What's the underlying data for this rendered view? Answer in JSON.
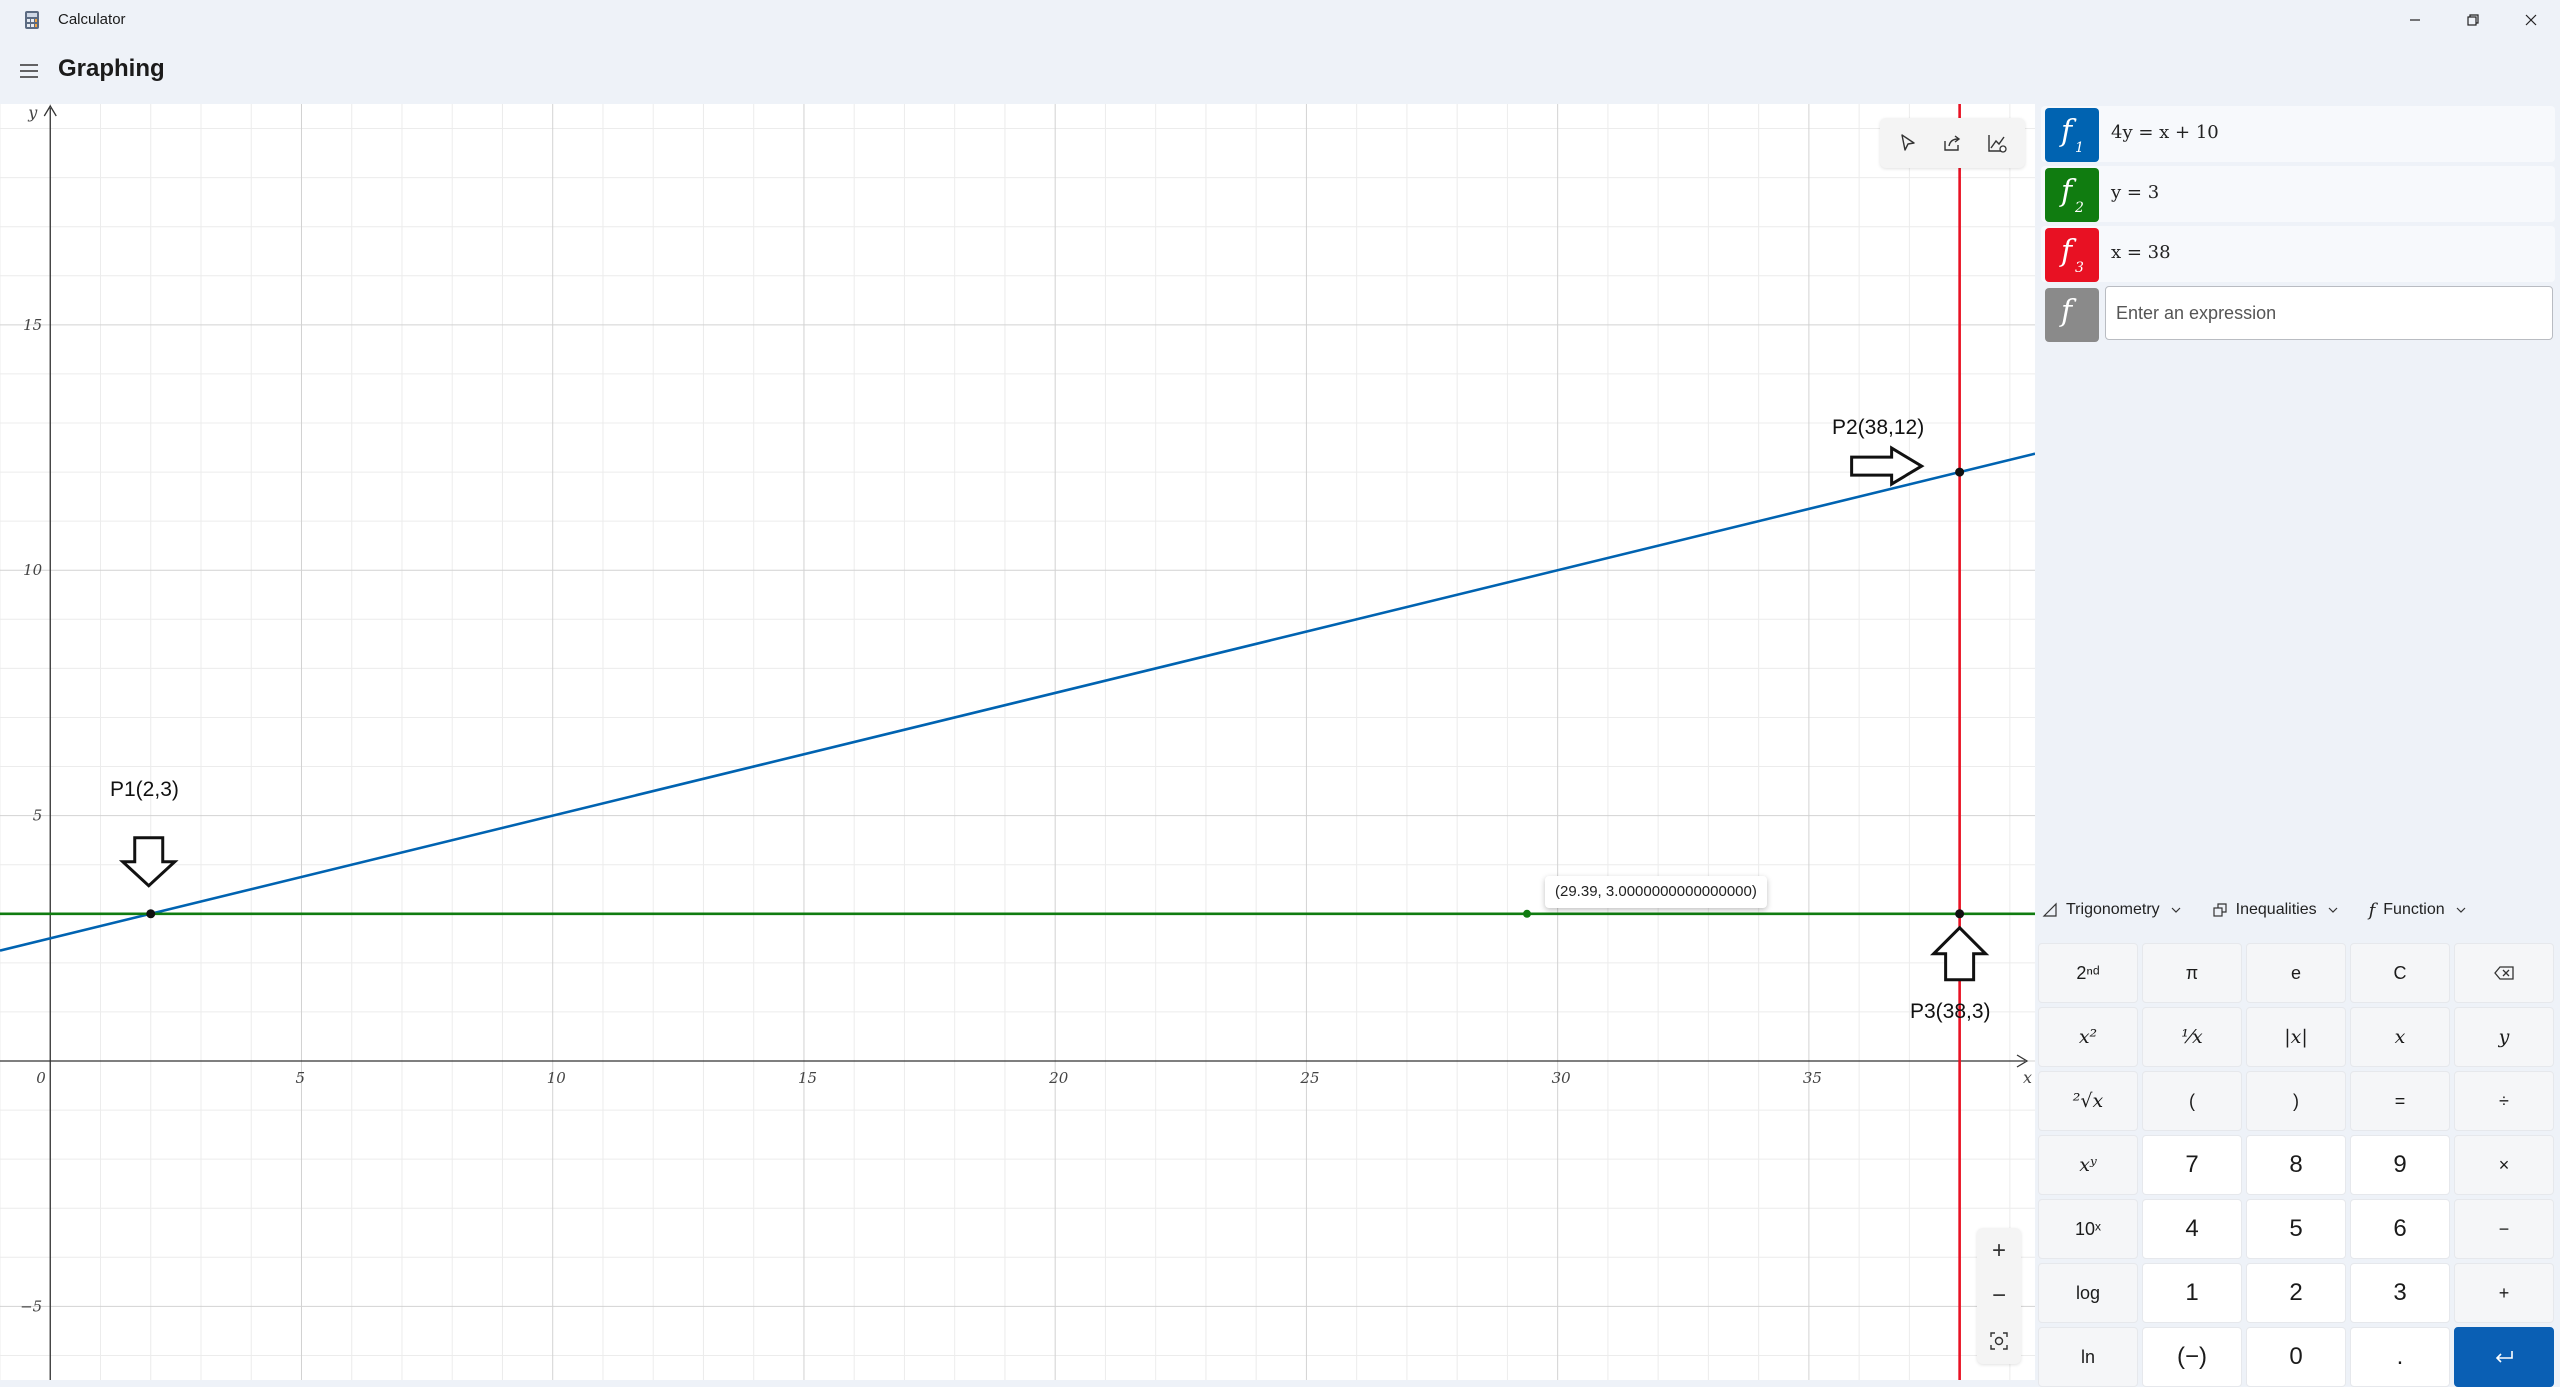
{
  "window": {
    "title": "Calculator",
    "controls": [
      "minimize",
      "maximize",
      "close"
    ]
  },
  "header": {
    "menu_icon": "hamburger-menu-icon",
    "page_title": "Graphing"
  },
  "graph": {
    "axes": {
      "x_label": "x",
      "y_label": "y",
      "x_ticks": [
        "0",
        "5",
        "10",
        "15",
        "20",
        "25",
        "30",
        "35"
      ],
      "y_ticks": [
        "15",
        "10",
        "5",
        "−5"
      ]
    },
    "annotations": {
      "p1": "P1(2,3)",
      "p2": "P2(38,12)",
      "p3": "P3(38,3)"
    },
    "trace_tooltip": "(29.39, 3.0000000000000000)",
    "tools": [
      "trace-pointer-icon",
      "share-icon",
      "graph-options-icon"
    ],
    "zoom": {
      "zoom_in": "+",
      "zoom_out": "−",
      "fit": "zoom-fit-icon"
    }
  },
  "chart_data": {
    "type": "line",
    "xlabel": "x",
    "ylabel": "y",
    "xlim": [
      -1,
      39.5
    ],
    "ylim": [
      -6.5,
      19.5
    ],
    "grid": true,
    "series": [
      {
        "name": "f1",
        "expression": "4y = x + 10",
        "color": "#0063b1",
        "kind": "line",
        "x": [
          -1,
          39.5
        ],
        "y": [
          2.25,
          12.375
        ]
      },
      {
        "name": "f2",
        "expression": "y = 3",
        "color": "#107c10",
        "kind": "horizontal",
        "y": 3
      },
      {
        "name": "f3",
        "expression": "x = 38",
        "color": "#e81123",
        "kind": "vertical",
        "x": 38
      }
    ],
    "points": [
      {
        "x": 2,
        "y": 3,
        "label": "P1(2,3)"
      },
      {
        "x": 38,
        "y": 12,
        "label": "P2(38,12)"
      },
      {
        "x": 38,
        "y": 3,
        "label": "P3(38,3)"
      },
      {
        "x": 29.39,
        "y": 3,
        "label": "(29.39, 3.0000000000000000)"
      }
    ]
  },
  "functions": [
    {
      "index": "1",
      "expression": "4y = x + 10",
      "color": "#0063b1"
    },
    {
      "index": "2",
      "expression": "y = 3",
      "color": "#107c10"
    },
    {
      "index": "3",
      "expression": "x = 38",
      "color": "#e81123"
    }
  ],
  "new_function": {
    "chip_color": "#8a8a8a",
    "placeholder": "Enter an expression"
  },
  "keypad": {
    "categories": [
      "Trigonometry",
      "Inequalities",
      "Function"
    ],
    "keys": [
      "2ⁿᵈ",
      "π",
      "e",
      "C",
      "backspace",
      "x²",
      "¹⁄x",
      "|x|",
      "x",
      "y",
      "²√x",
      "(",
      ")",
      "=",
      "÷",
      "xʸ",
      "7",
      "8",
      "9",
      "×",
      "10ˣ",
      "4",
      "5",
      "6",
      "−",
      "log",
      "1",
      "2",
      "3",
      "+",
      "ln",
      "(−)",
      "0",
      ".",
      "enter"
    ]
  }
}
